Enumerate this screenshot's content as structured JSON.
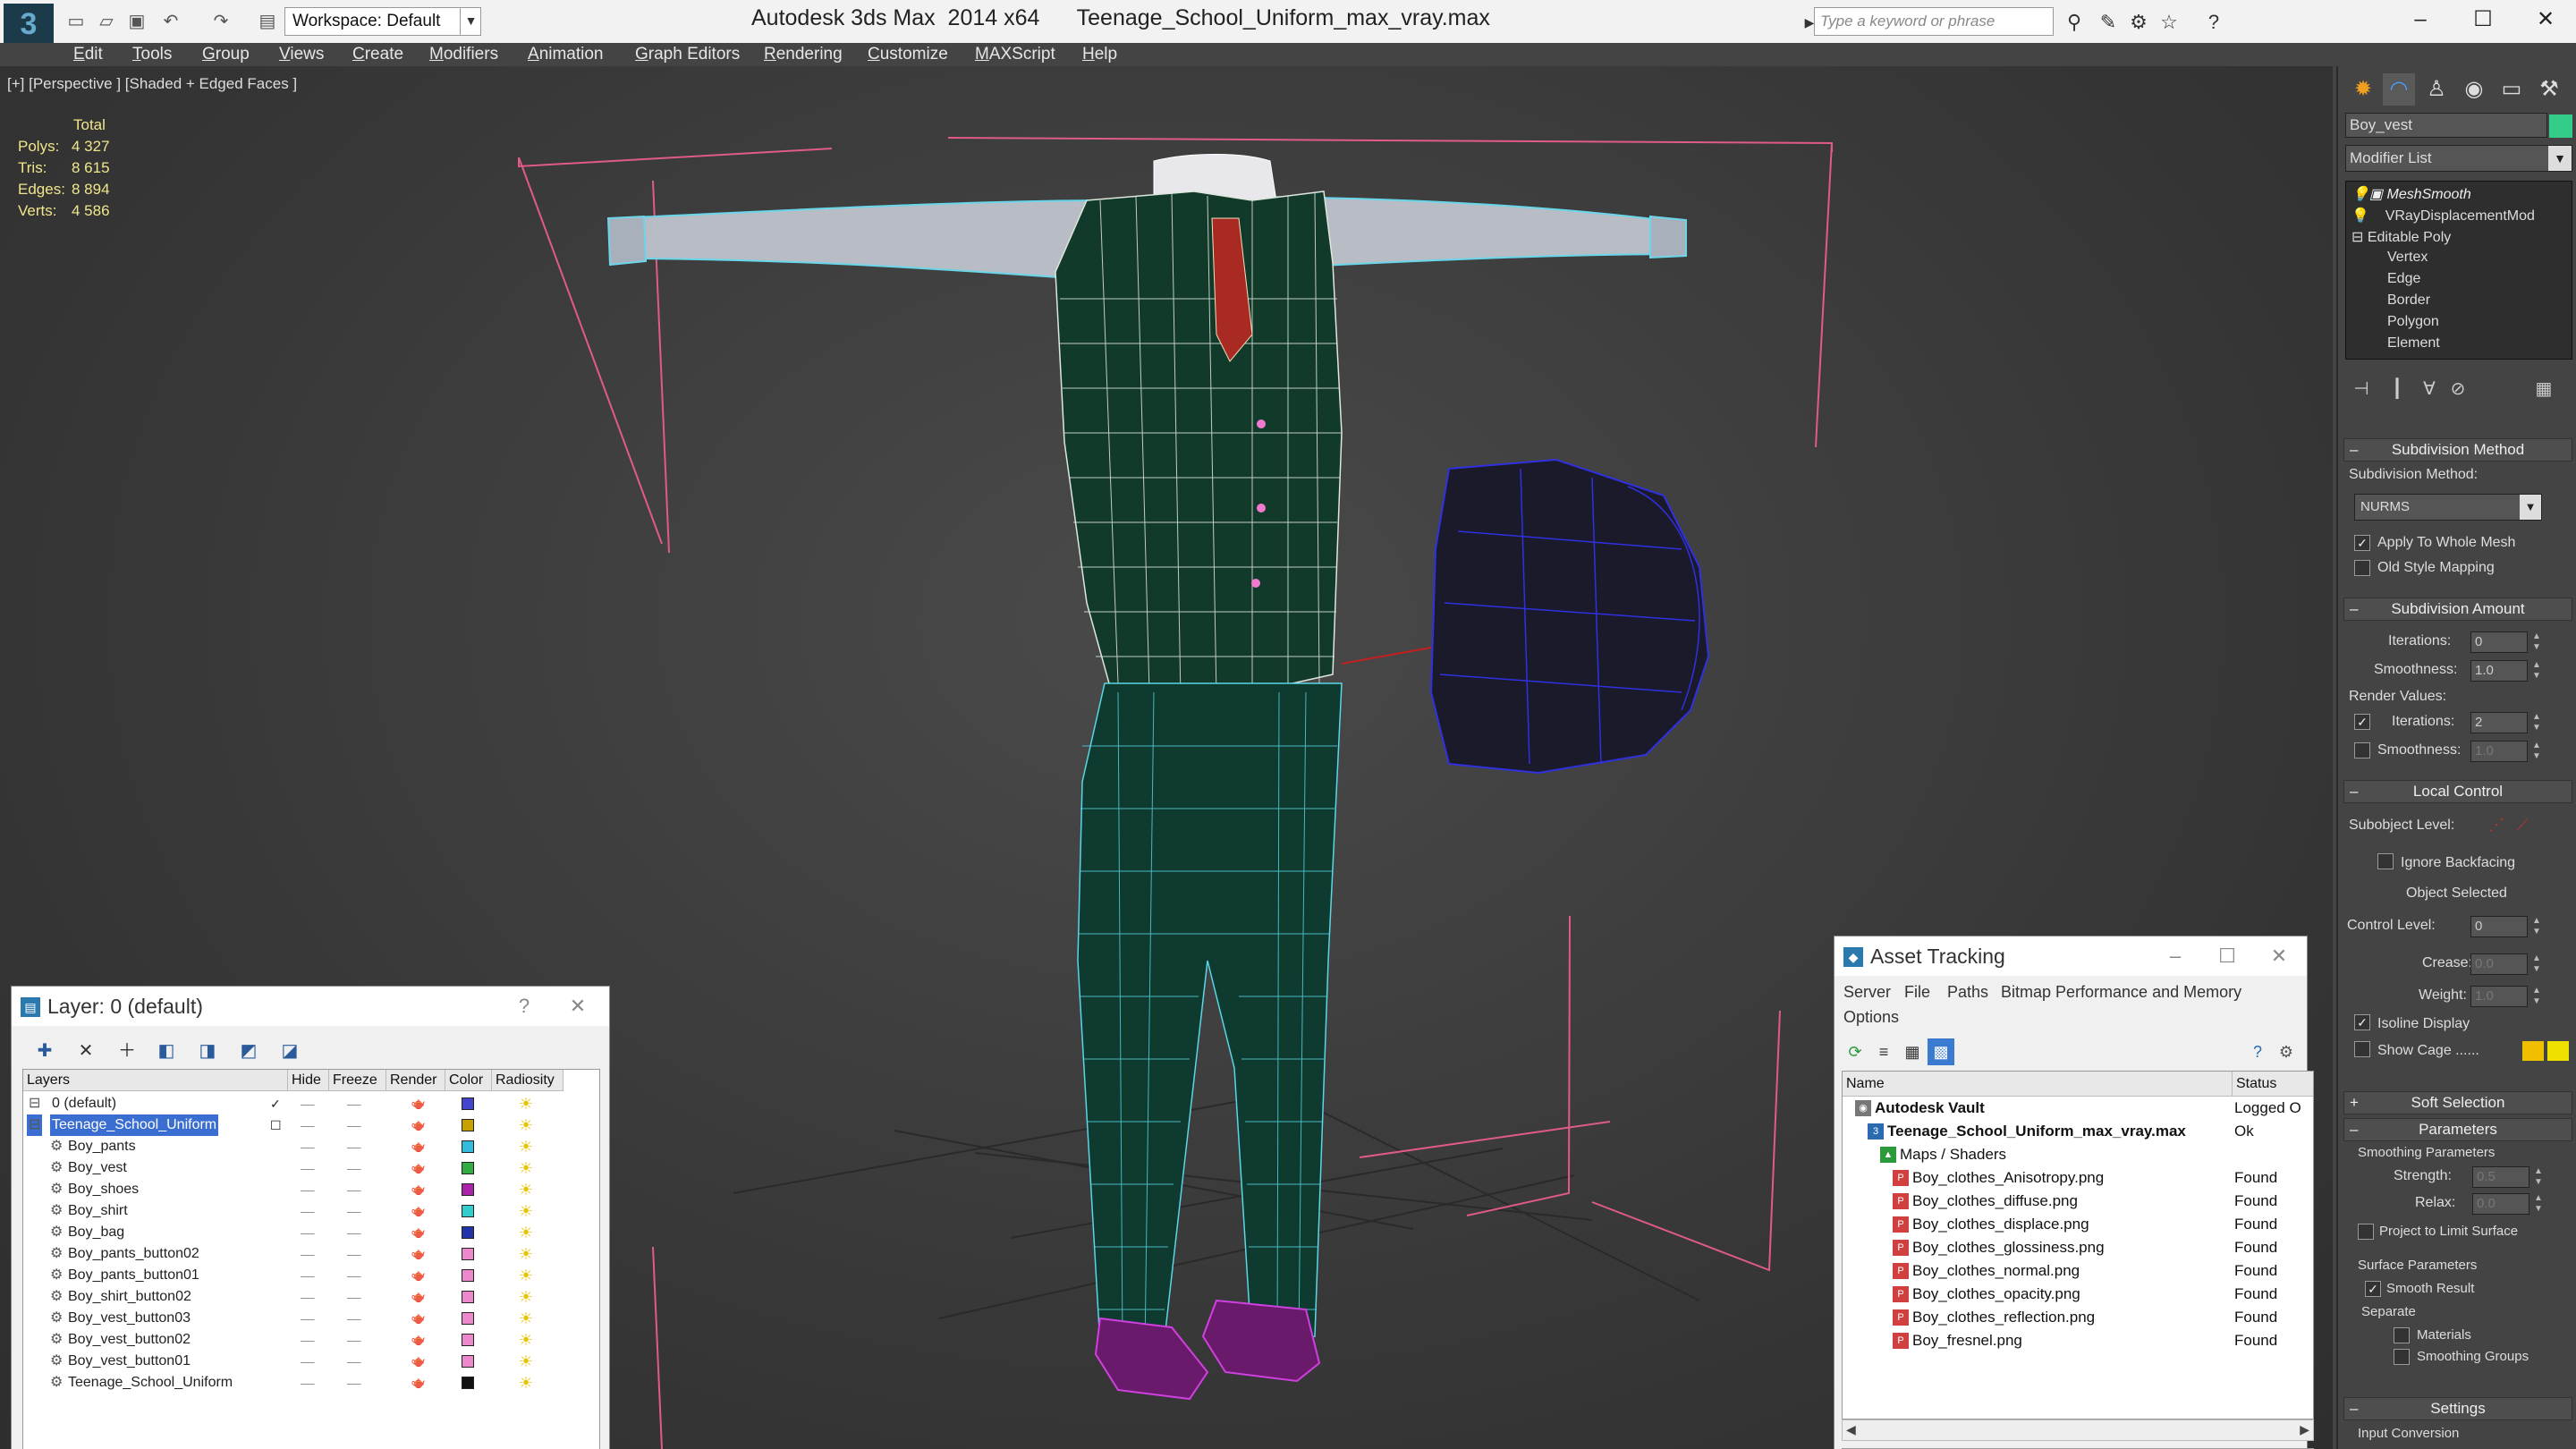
{
  "app": {
    "title": "Autodesk 3ds Max  2014 x64      Teenage_School_Uniform_max_vray.max",
    "logo": "3",
    "workspace": "Workspace: Default",
    "search_placeholder": "Type a keyword or phrase"
  },
  "menu": [
    "Edit",
    "Tools",
    "Group",
    "Views",
    "Create",
    "Modifiers",
    "Animation",
    "Graph Editors",
    "Rendering",
    "Customize",
    "MAXScript",
    "Help"
  ],
  "viewport": {
    "label": "[+] [Perspective ] [Shaded + Edged Faces ]",
    "stats": {
      "total_label": "Total",
      "rows": [
        {
          "k": "Polys:",
          "v": "4 327"
        },
        {
          "k": "Tris:",
          "v": "8 615"
        },
        {
          "k": "Edges:",
          "v": "8 894"
        },
        {
          "k": "Verts:",
          "v": "4 586"
        }
      ]
    }
  },
  "command_panel": {
    "object_name": "Boy_vest",
    "object_color": "#33cc88",
    "modifier_list": "Modifier List",
    "stack": [
      "MeshSmooth",
      "VRayDisplacementMod",
      "Editable Poly",
      "Vertex",
      "Edge",
      "Border",
      "Polygon",
      "Element"
    ],
    "rollouts": {
      "subdivision_method": {
        "title": "Subdivision Method",
        "label": "Subdivision Method:",
        "value": "NURMS",
        "apply_whole_mesh": "Apply To Whole Mesh",
        "old_style_mapping": "Old Style Mapping"
      },
      "subdivision_amount": {
        "title": "Subdivision Amount",
        "iterations_label": "Iterations:",
        "iterations": "0",
        "smoothness_label": "Smoothness:",
        "smoothness": "1.0",
        "render_values": "Render Values:",
        "r_iterations_label": "Iterations:",
        "r_iterations": "2",
        "r_smoothness_label": "Smoothness:",
        "r_smoothness": "1.0"
      },
      "local_control": {
        "title": "Local Control",
        "subobject_level": "Subobject Level:",
        "ignore_backfacing": "Ignore Backfacing",
        "object_selected": "Object Selected",
        "control_level_label": "Control Level:",
        "control_level": "0",
        "crease_label": "Crease:",
        "crease": "0.0",
        "weight_label": "Weight:",
        "weight": "1.0",
        "isoline_display": "Isoline Display",
        "show_cage": "Show Cage ......",
        "cage_color1": "#f0c000",
        "cage_color2": "#f0e000"
      },
      "soft_selection": {
        "title": "Soft Selection"
      },
      "parameters": {
        "title": "Parameters",
        "smoothing_params": "Smoothing Parameters",
        "strength_label": "Strength:",
        "strength": "0.5",
        "relax_label": "Relax:",
        "relax": "0.0",
        "project_limit": "Project to Limit Surface",
        "surface_params": "Surface Parameters",
        "smooth_result": "Smooth Result",
        "separate": "Separate",
        "materials": "Materials",
        "smoothing_groups": "Smoothing Groups"
      },
      "settings": {
        "title": "Settings",
        "input_conversion": "Input Conversion"
      }
    }
  },
  "layer_dialog": {
    "title": "Layer: 0 (default)",
    "help": "?",
    "close": "✕",
    "headers": [
      "Layers",
      "Hide",
      "Freeze",
      "Render",
      "Color",
      "Radiosity"
    ],
    "rows": [
      {
        "name": "0 (default)",
        "color": "#4444cc",
        "indent": 0,
        "check": "✓"
      },
      {
        "name": "Teenage_School_Uniform",
        "color": "#c8a000",
        "indent": 0,
        "check": "☐",
        "selected": true
      },
      {
        "name": "Boy_pants",
        "color": "#33bbdd",
        "indent": 1
      },
      {
        "name": "Boy_vest",
        "color": "#33aa44",
        "indent": 1
      },
      {
        "name": "Boy_shoes",
        "color": "#aa22aa",
        "indent": 1
      },
      {
        "name": "Boy_shirt",
        "color": "#33cccc",
        "indent": 1
      },
      {
        "name": "Boy_bag",
        "color": "#2233aa",
        "indent": 1
      },
      {
        "name": "Boy_pants_button02",
        "color": "#ee88cc",
        "indent": 1
      },
      {
        "name": "Boy_pants_button01",
        "color": "#ee88cc",
        "indent": 1
      },
      {
        "name": "Boy_shirt_button02",
        "color": "#ee88cc",
        "indent": 1
      },
      {
        "name": "Boy_vest_button03",
        "color": "#ee88cc",
        "indent": 1
      },
      {
        "name": "Boy_vest_button02",
        "color": "#ee88cc",
        "indent": 1
      },
      {
        "name": "Boy_vest_button01",
        "color": "#ee88cc",
        "indent": 1
      },
      {
        "name": "Teenage_School_Uniform",
        "color": "#111111",
        "indent": 1
      }
    ]
  },
  "asset_dialog": {
    "title": "Asset Tracking",
    "menu": [
      "Server",
      "File",
      "Paths",
      "Bitmap Performance and Memory",
      "Options"
    ],
    "headers": [
      "Name",
      "Status"
    ],
    "rows": [
      {
        "name": "Autodesk Vault",
        "status": "Logged O",
        "indent": 1,
        "icon": "vault"
      },
      {
        "name": "Teenage_School_Uniform_max_vray.max",
        "status": "Ok",
        "indent": 2,
        "icon": "max"
      },
      {
        "name": "Maps / Shaders",
        "status": "",
        "indent": 3,
        "icon": "maps"
      },
      {
        "name": "Boy_clothes_Anisotropy.png",
        "status": "Found",
        "indent": 4,
        "icon": "png"
      },
      {
        "name": "Boy_clothes_diffuse.png",
        "status": "Found",
        "indent": 4,
        "icon": "png"
      },
      {
        "name": "Boy_clothes_displace.png",
        "status": "Found",
        "indent": 4,
        "icon": "png"
      },
      {
        "name": "Boy_clothes_glossiness.png",
        "status": "Found",
        "indent": 4,
        "icon": "png"
      },
      {
        "name": "Boy_clothes_normal.png",
        "status": "Found",
        "indent": 4,
        "icon": "png"
      },
      {
        "name": "Boy_clothes_opacity.png",
        "status": "Found",
        "indent": 4,
        "icon": "png"
      },
      {
        "name": "Boy_clothes_reflection.png",
        "status": "Found",
        "indent": 4,
        "icon": "png"
      },
      {
        "name": "Boy_fresnel.png",
        "status": "Found",
        "indent": 4,
        "icon": "png"
      }
    ]
  }
}
